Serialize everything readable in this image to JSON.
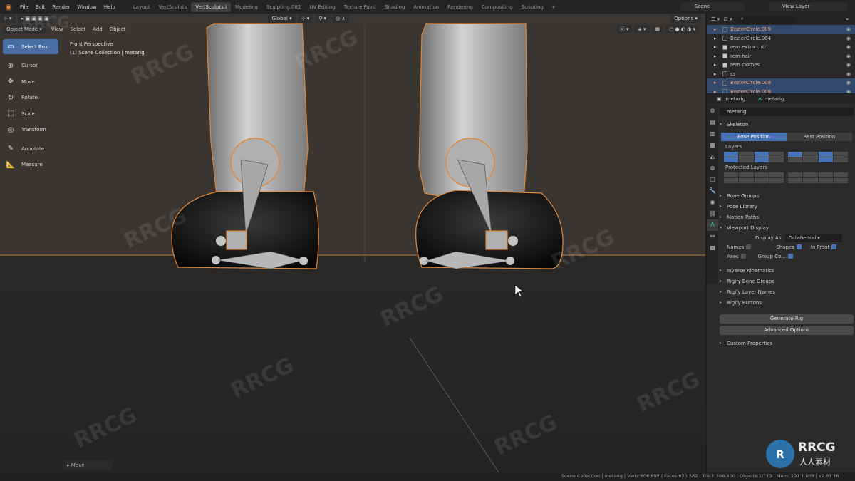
{
  "app": {
    "menu": [
      "File",
      "Edit",
      "Render",
      "Window",
      "Help"
    ],
    "workspaces": [
      "Layout",
      "VertSculpts",
      "VertSculpts.l",
      "Modeling",
      "Sculpting.002",
      "UV Editing",
      "Texture Paint",
      "Shading",
      "Animation",
      "Rendering",
      "Compositing",
      "Scripting"
    ],
    "active_workspace": "VertSculpts.l",
    "scene": "Scene",
    "view_layer": "View Layer"
  },
  "viewport": {
    "mode": "Object Mode",
    "menus": [
      "View",
      "Select",
      "Add",
      "Object"
    ],
    "transform_orientation": "Global",
    "options_label": "Options",
    "perspective": "Front Perspective",
    "collection_info": "(1) Scene Collection | metarig",
    "tools": [
      {
        "label": "Select Box",
        "icon": "select-box-icon",
        "glyph": "▭",
        "active": true
      },
      {
        "label": "Cursor",
        "icon": "cursor-icon",
        "glyph": "⊕",
        "active": false
      },
      {
        "label": "Move",
        "icon": "move-icon",
        "glyph": "✥",
        "active": false
      },
      {
        "label": "Rotate",
        "icon": "rotate-icon",
        "glyph": "↻",
        "active": false
      },
      {
        "label": "Scale",
        "icon": "scale-icon",
        "glyph": "⬚",
        "active": false
      },
      {
        "label": "Transform",
        "icon": "transform-icon",
        "glyph": "◎",
        "active": false
      },
      {
        "label": "Annotate",
        "icon": "annotate-icon",
        "glyph": "✎",
        "active": false
      },
      {
        "label": "Measure",
        "icon": "measure-icon",
        "glyph": "📐",
        "active": false
      }
    ],
    "last_operator": "Move"
  },
  "outliner": {
    "rows": [
      {
        "label": "BezierCircle.009",
        "selected": true,
        "checked": false
      },
      {
        "label": "BezierCircle.004",
        "selected": false,
        "checked": false
      },
      {
        "label": "rem extra cntrl",
        "selected": false,
        "checked": true
      },
      {
        "label": "rem hair",
        "selected": false,
        "checked": true
      },
      {
        "label": "rem clothes",
        "selected": false,
        "checked": true
      },
      {
        "label": "cs",
        "selected": false,
        "checked": false
      },
      {
        "label": "BezierCircle.009",
        "selected": true,
        "checked": false
      },
      {
        "label": "BezierCircle.008",
        "selected": true,
        "checked": false
      }
    ]
  },
  "properties": {
    "object_name": "metarig",
    "data_name": "metarig",
    "armature_field": "metarig",
    "skeleton_label": "Skeleton",
    "pose_position": "Pose Position",
    "rest_position": "Rest Position",
    "layers_label": "Layers",
    "protected_layers_label": "Protected Layers",
    "panels_a": [
      "Bone Groups",
      "Pose Library",
      "Motion Paths",
      "Viewport Display"
    ],
    "display_as_label": "Display As",
    "display_as_value": "Octahedral",
    "names_label": "Names",
    "shapes_label": "Shapes",
    "in_front_label": "In Front",
    "axes_label": "Axes",
    "group_colors_label": "Group Co...",
    "panels_b": [
      "Inverse Kinematics",
      "Rigify Bone Groups",
      "Rigify Layer Names",
      "Rigify Buttons"
    ],
    "generate_rig": "Generate Rig",
    "advanced_options": "Advanced Options",
    "custom_properties": "Custom Properties"
  },
  "status": {
    "text": "Scene Collection | metarig | Verts:606,695 | Faces:620,582 | Tris:1,208,800 | Objects:1/113 | Mem: 191.1 MiB | v2.81.16"
  },
  "watermark": {
    "brand": "RRCG",
    "chinese": "人人素材"
  },
  "colors": {
    "accent": "#4772b3",
    "outline": "#e0883a",
    "bone": "#b8b8b8"
  }
}
